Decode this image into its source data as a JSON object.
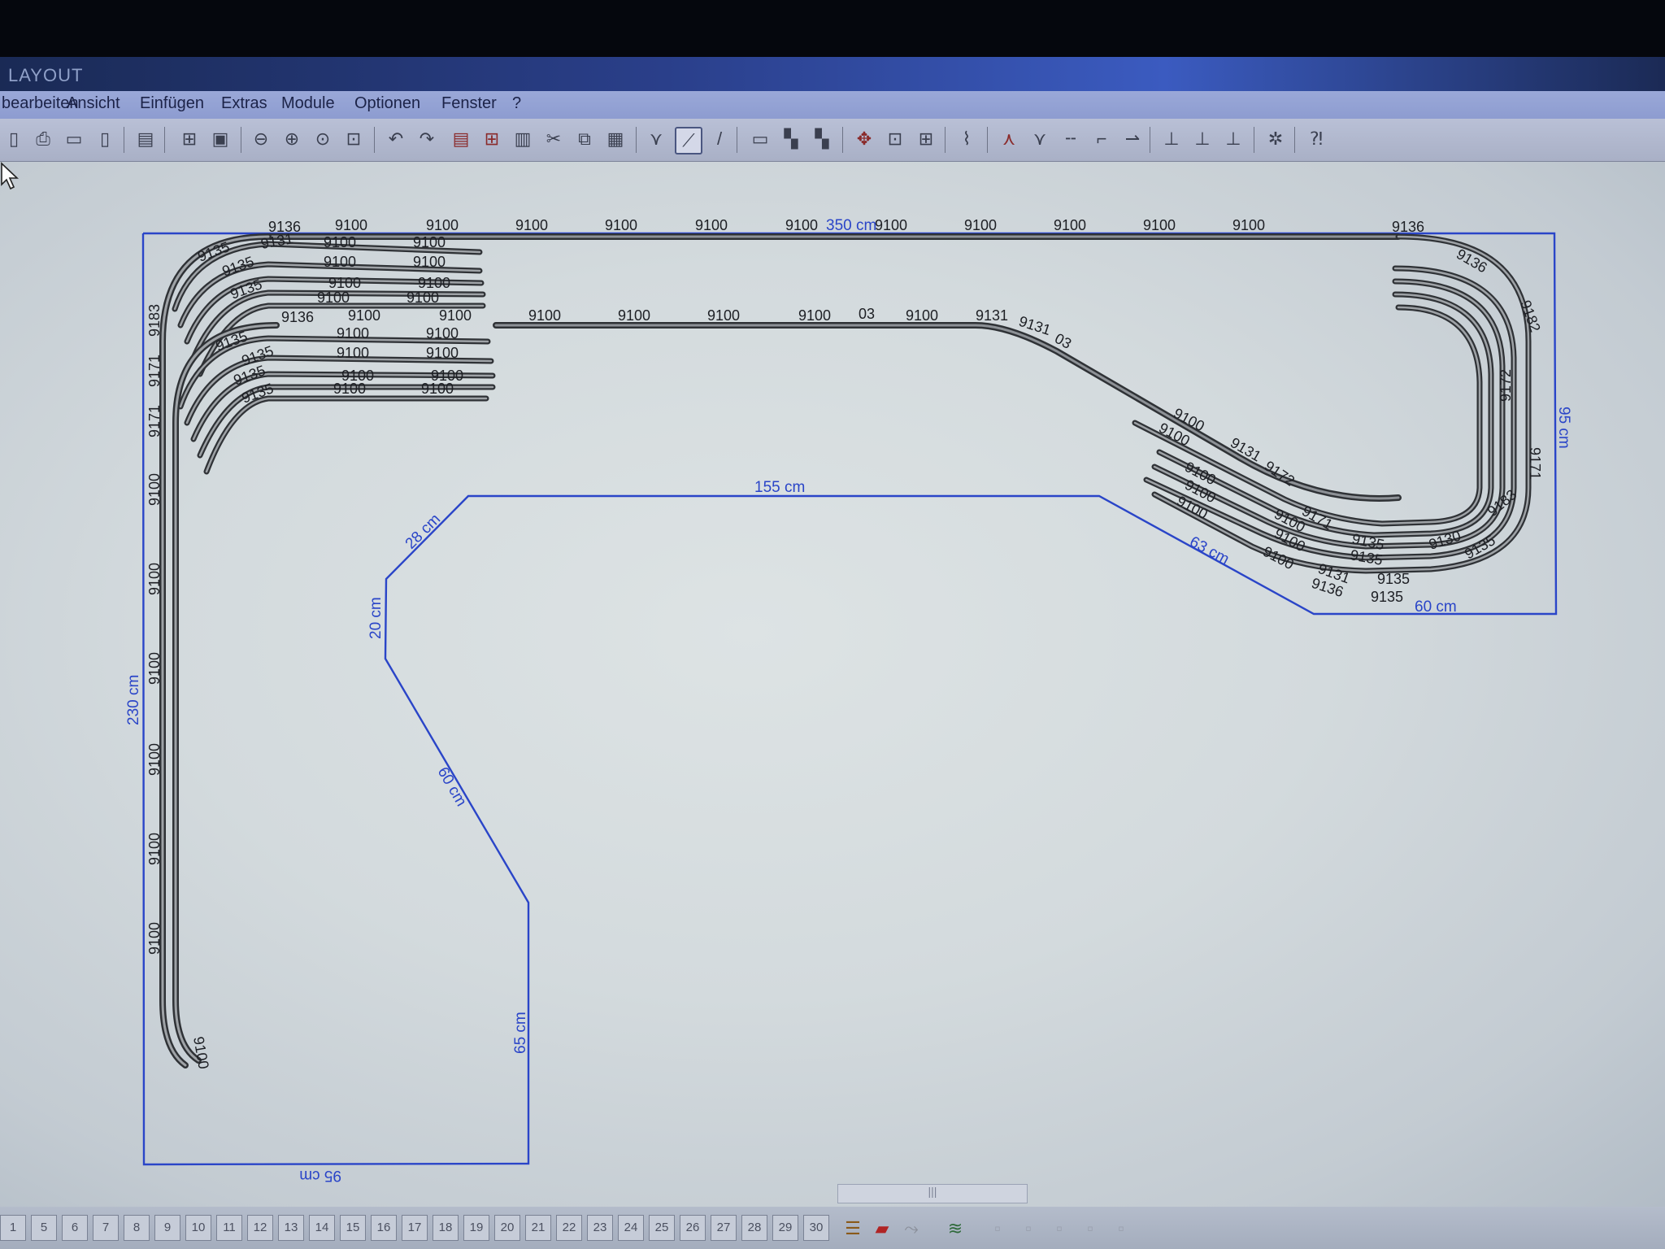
{
  "window": {
    "title": "LAYOUT"
  },
  "menu": [
    "bearbeiten",
    "Ansicht",
    "Einfügen",
    "Extras",
    "Module",
    "Optionen",
    "Fenster",
    "?"
  ],
  "toolbar_icons": [
    "new-page-icon",
    "print-icon",
    "preview-icon",
    "clipboard-icon",
    "open-folder-icon",
    "grid-icon",
    "image-icon",
    "zoom-out-icon",
    "zoom-in-icon",
    "zoom-select-icon",
    "zoom-fit-icon",
    "undo-icon",
    "redo-icon",
    "delete-icon",
    "group-icon",
    "ungroup-icon",
    "cut-icon",
    "copy-icon",
    "paste-icon",
    "switch-icon",
    "curve-track-icon",
    "straight-track-icon",
    "layer-icon",
    "align-icon",
    "align-icon",
    "rotate-icon",
    "flip-icon",
    "move-icon",
    "measure-icon",
    "turnout-icon",
    "turnout-icon",
    "joiner-icon",
    "joiner-icon",
    "joiner-icon",
    "height-icon",
    "height-icon",
    "height-icon",
    "settings-icon",
    "help-icon"
  ],
  "dimensions": {
    "top": "350 cm",
    "inner_top": "155 cm",
    "diag_left": "28 cm",
    "left_small": "20 cm",
    "left_outer": "230 cm",
    "diag_lower": "60 cm",
    "inner_right": "65 cm",
    "bottom": "95 cm",
    "diag_right": "63 cm",
    "bottom_right": "60 cm",
    "right": "95 cm"
  },
  "track_labels": {
    "top_row": [
      "9136",
      "9100",
      "9100",
      "9100",
      "9100",
      "9100",
      "9100",
      "9100",
      "9100",
      "9100",
      "9100",
      "9100",
      "9136"
    ],
    "second_row": [
      "9136",
      "9100",
      "9100",
      "9100",
      "9100",
      "9100",
      "9100",
      "03",
      "9100",
      "9131",
      "9131",
      "03"
    ],
    "left_curves": [
      "9135",
      "9131",
      "9135",
      "9135",
      "9135",
      "9135",
      "9135",
      "9135"
    ],
    "left_stubs": [
      "9100",
      "9100",
      "9100",
      "9100",
      "9100",
      "9100",
      "9100",
      "9100",
      "9100",
      "9100",
      "9100",
      "9100",
      "9100",
      "9100",
      "9100",
      "9100"
    ],
    "left_vertical": [
      "9183",
      "9171",
      "9171",
      "9100",
      "9100",
      "9100",
      "9100",
      "9100",
      "9100",
      "9100"
    ],
    "right_ramp": [
      "9100",
      "9100",
      "9131",
      "9172",
      "9100",
      "9100",
      "9171",
      "9100",
      "9100",
      "9100",
      "9100"
    ],
    "right_loop": [
      "9135",
      "9136",
      "9182",
      "9172",
      "9171",
      "9130",
      "9183",
      "9135",
      "9131",
      "9135",
      "9136",
      "9135",
      "9135"
    ]
  },
  "page_tabs": [
    "1",
    "5",
    "6",
    "7",
    "8",
    "9",
    "10",
    "11",
    "12",
    "13",
    "14",
    "15",
    "16",
    "17",
    "18",
    "19",
    "20",
    "21",
    "22",
    "23",
    "24",
    "25",
    "26",
    "27",
    "28",
    "29",
    "30"
  ],
  "scroll_label": "|||"
}
